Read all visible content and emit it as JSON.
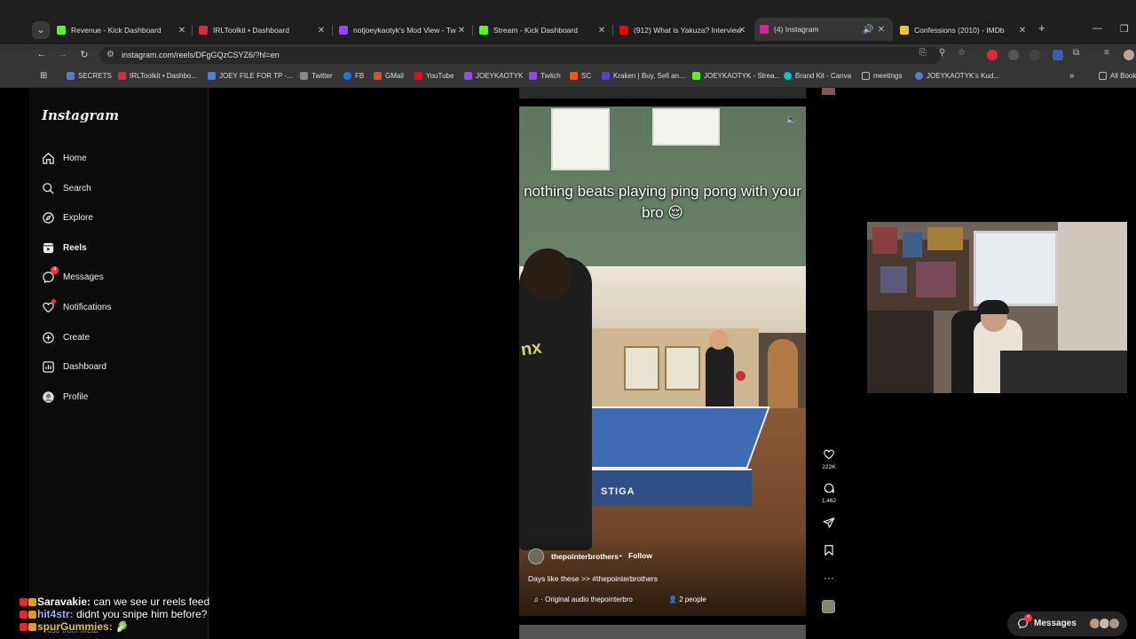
{
  "browser": {
    "tabs": [
      {
        "title": "Revenue - Kick Dashboard",
        "favicon_color": "#53fc18"
      },
      {
        "title": "IRLToolkit • Dashboard",
        "favicon_color": "#e0283c"
      },
      {
        "title": "notjoeykaotyk's Mod View - Tw",
        "favicon_color": "#9146ff"
      },
      {
        "title": "Stream - Kick Dashboard",
        "favicon_color": "#53fc18"
      },
      {
        "title": "(912) What is Yakuza? Interview",
        "favicon_color": "#ff0000"
      },
      {
        "title": "(4) Instagram",
        "favicon_color": "#d6249f"
      },
      {
        "title": "Confessions (2010) - IMDb",
        "favicon_color": "#f5c518"
      }
    ],
    "url": "instagram.com/reels/DFgGQzCSYZ6/?hl=en",
    "bookmarks": [
      {
        "label": "SECRETS",
        "color": "#4a7fd6"
      },
      {
        "label": "IRLToolkit • Dashbo...",
        "color": "#e0283c"
      },
      {
        "label": "JOEY FILE FOR TP -...",
        "color": "#4a7fd6"
      },
      {
        "label": "Twitter",
        "color": "#888888"
      },
      {
        "label": "FB",
        "color": "#1877f2"
      },
      {
        "label": "GMail",
        "color": "#ea4335"
      },
      {
        "label": "YouTube",
        "color": "#ff0000"
      },
      {
        "label": "JOEYKAOTYK",
        "color": "#9146ff"
      },
      {
        "label": "Twitch",
        "color": "#9146ff"
      },
      {
        "label": "SC",
        "color": "#ff5500"
      },
      {
        "label": "Kraken | Buy, Sell an...",
        "color": "#5741d9"
      },
      {
        "label": "JOEYKAOTYK - Strea...",
        "color": "#53fc18"
      },
      {
        "label": "Brand Kit - Canva",
        "color": "#00c4cc"
      },
      {
        "label": "meetings",
        "color": "#999999"
      },
      {
        "label": "JOEYKAOTYK's Kud...",
        "color": "#4a7fd6"
      }
    ],
    "all_bookmarks": "All Bookmarks"
  },
  "sidebar": {
    "logo": "Instagram",
    "items": [
      {
        "label": "Home",
        "icon": "home-icon"
      },
      {
        "label": "Search",
        "icon": "search-icon"
      },
      {
        "label": "Explore",
        "icon": "compass-icon"
      },
      {
        "label": "Reels",
        "icon": "reels-icon"
      },
      {
        "label": "Messages",
        "icon": "messenger-icon",
        "badge": "4"
      },
      {
        "label": "Notifications",
        "icon": "heart-icon"
      },
      {
        "label": "Create",
        "icon": "plus-square-icon"
      },
      {
        "label": "Dashboard",
        "icon": "chart-icon"
      },
      {
        "label": "Profile",
        "icon": "avatar-icon"
      }
    ],
    "also_from_meta": "Also from Meta"
  },
  "reel": {
    "caption": "nothing beats playing ping pong with your bro 😌",
    "table_brand": "STIGA",
    "shirt_print": "nx",
    "username": "thepointerbrothers",
    "follow_sep": "•",
    "follow": "Follow",
    "description": "Days like these >> #thepointerbrothers",
    "audio": "Original audio  thepointerbro",
    "people": "2 people",
    "likes": "222K",
    "comments": "1,462"
  },
  "chat": [
    {
      "user": "Saravakie:",
      "message": " can we see ur reels feed",
      "user_color": "#ffffff"
    },
    {
      "user": "hit4str:",
      "message": " didnt you snipe him before?",
      "user_color": "#a0a8ff"
    },
    {
      "user": "spurGummies:",
      "message": " 🥬",
      "user_color": "#e0c23a"
    }
  ],
  "messages_pill": {
    "label": "Messages",
    "badge": "4"
  }
}
